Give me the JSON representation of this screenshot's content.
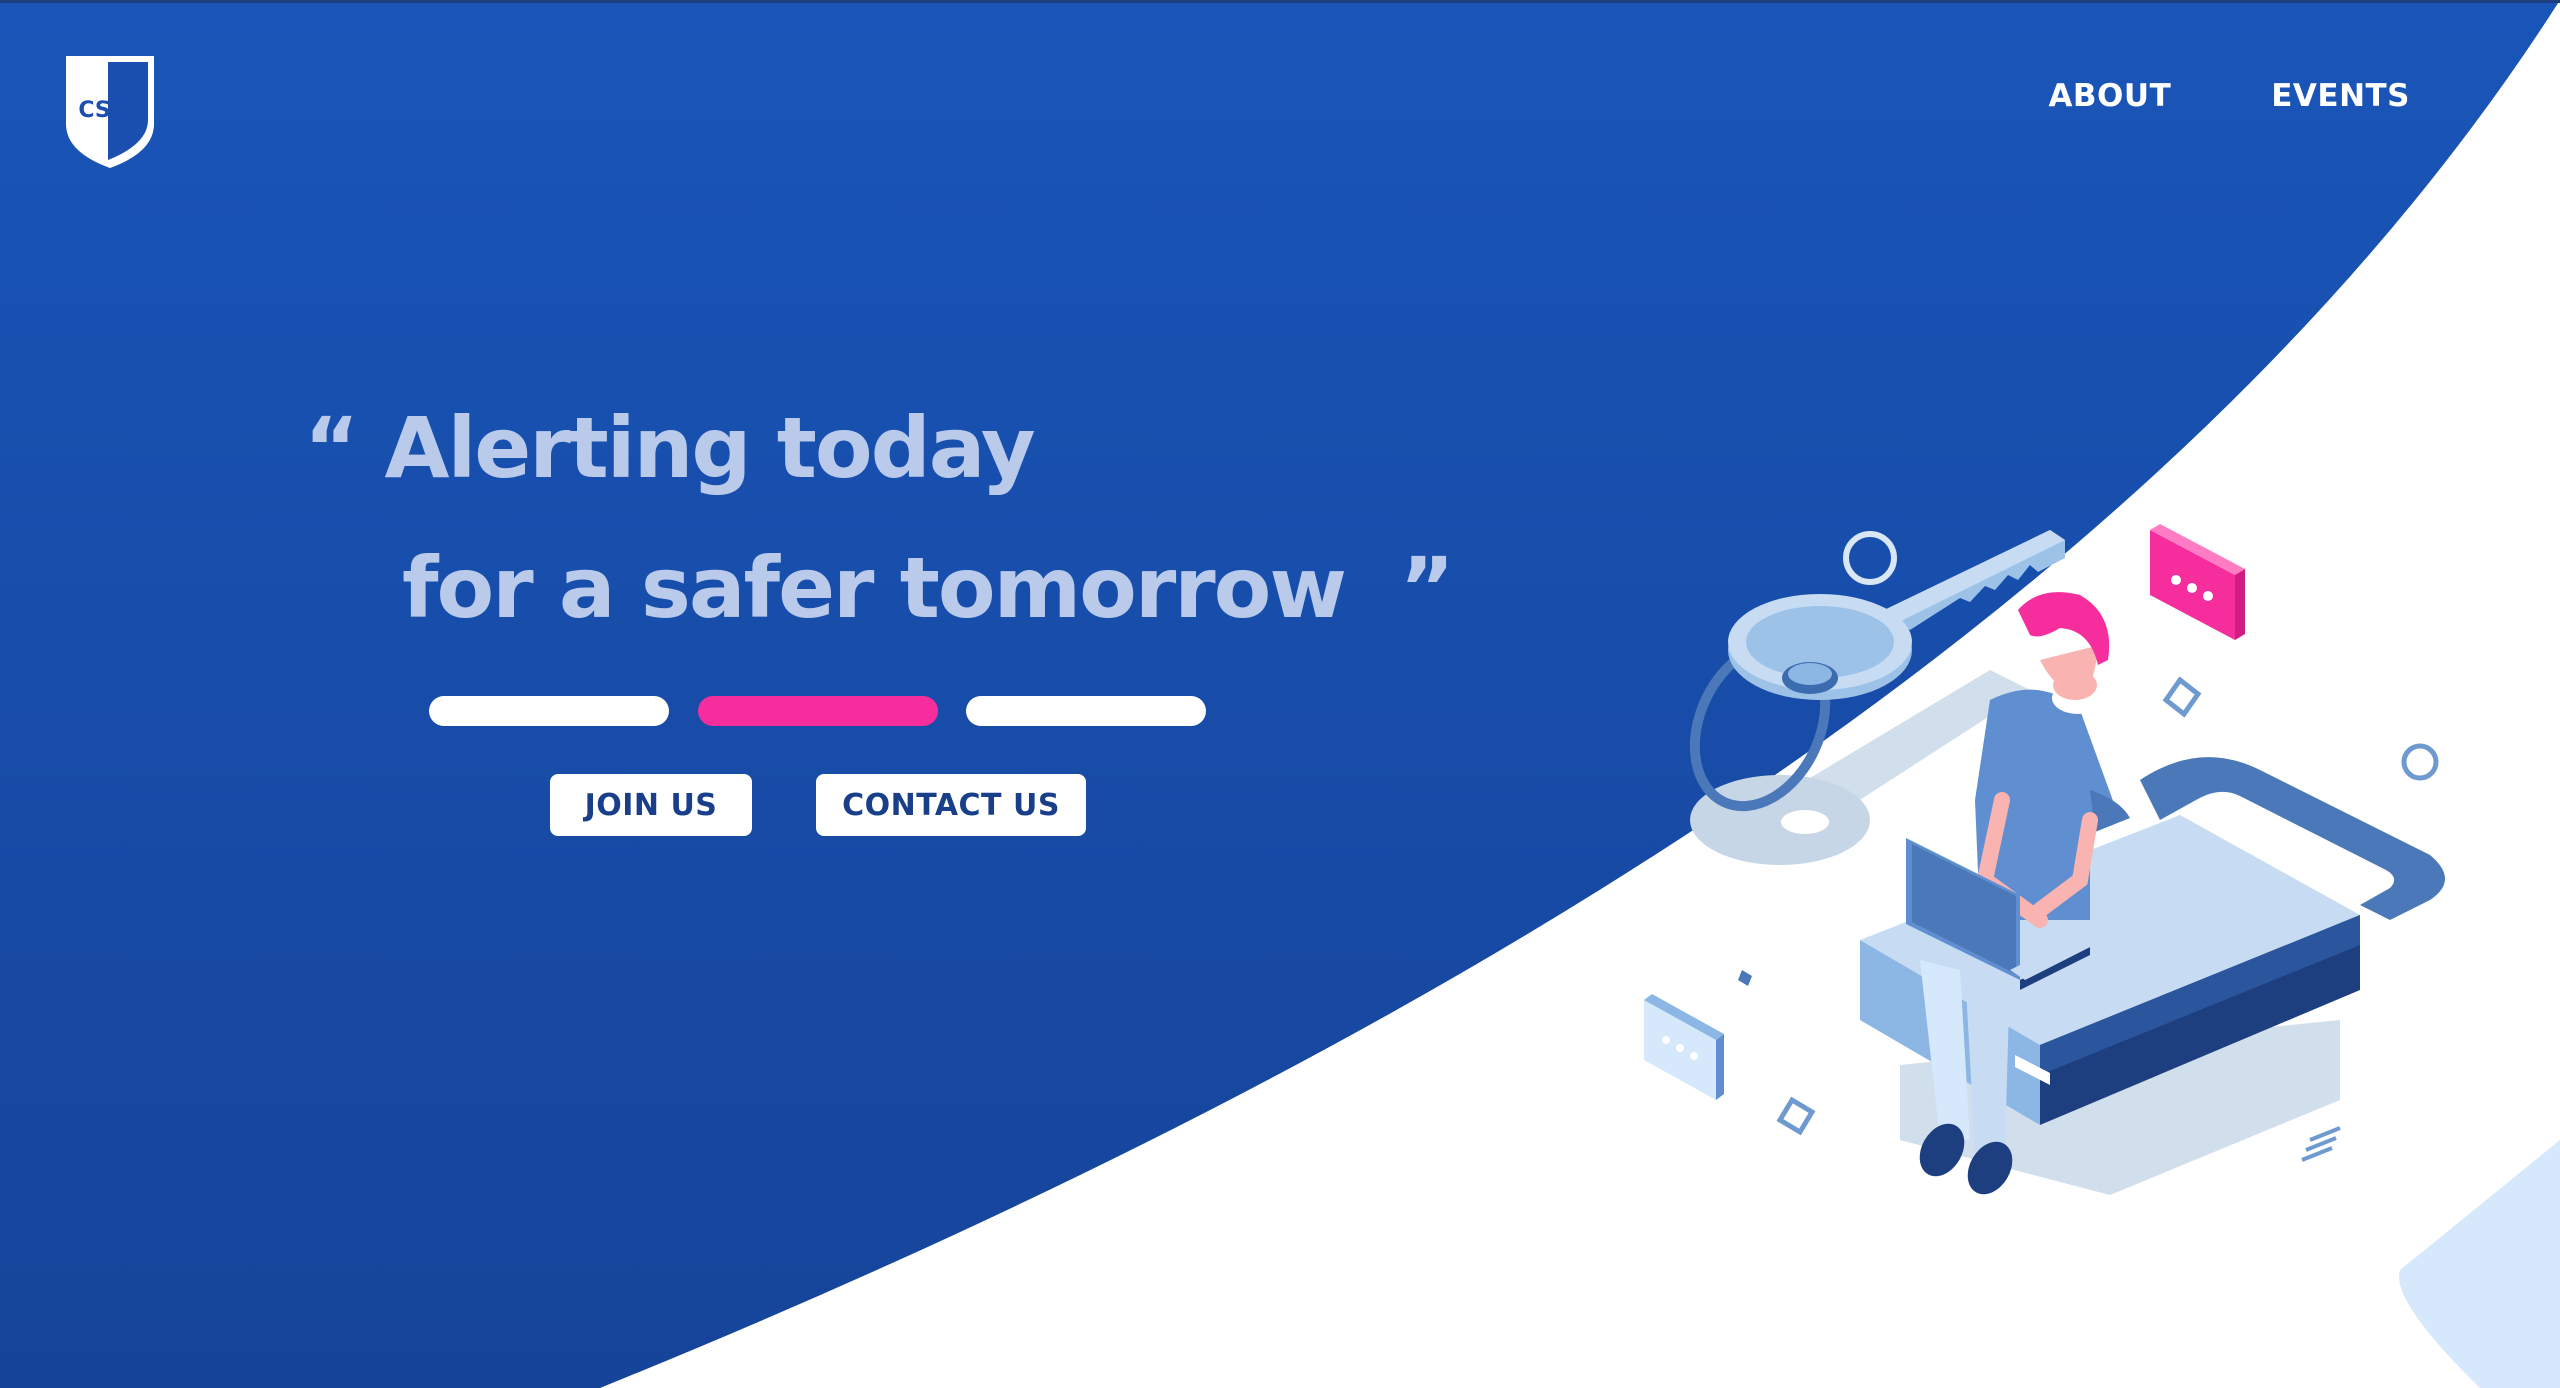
{
  "brand": {
    "logo_text": "CSFS"
  },
  "nav": {
    "about": "ABOUT",
    "events": "EVENTS"
  },
  "hero": {
    "quote_line_1": "“ Alerting today",
    "quote_line_2": "for a safer tomorrow  ”"
  },
  "buttons": {
    "join": "JOIN US",
    "contact": "CONTACT US"
  },
  "colors": {
    "primary": "#1a4fb0",
    "accent_pink": "#f62d9c",
    "quote_text": "#b9caea",
    "white": "#ffffff"
  },
  "icons": [
    "shield-logo-icon",
    "key-icon",
    "padlock-icon",
    "laptop-icon",
    "chat-bubble-icon"
  ]
}
